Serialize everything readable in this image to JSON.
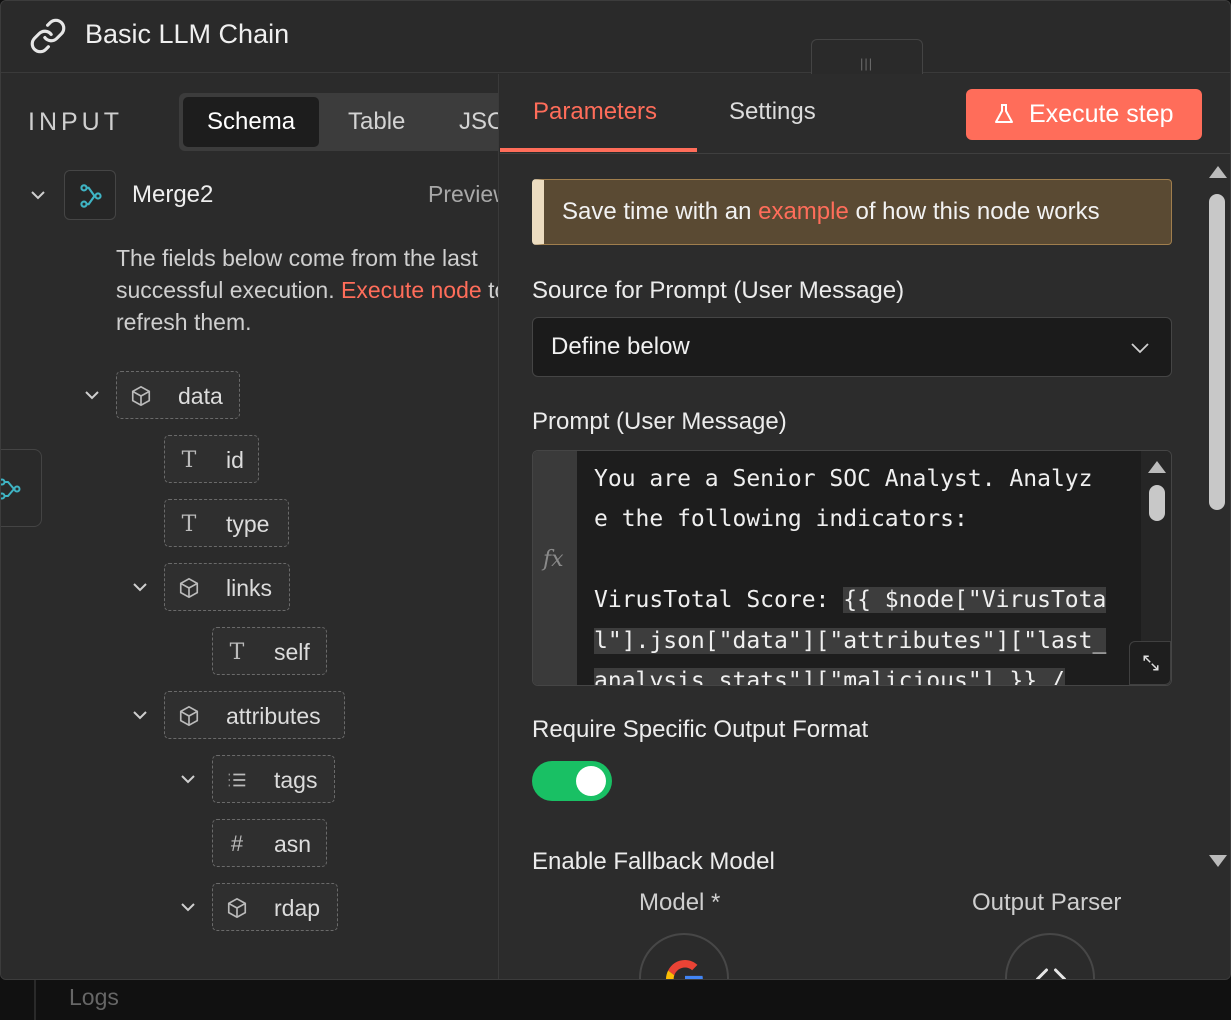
{
  "header": {
    "title": "Basic LLM Chain",
    "icon": "link-icon"
  },
  "input_panel": {
    "label": "INPUT",
    "view_tabs": [
      "Schema",
      "Table",
      "JSON"
    ],
    "active_tab": "Schema",
    "node": {
      "name": "Merge2",
      "preview_label": "Preview"
    },
    "description": {
      "before": "The fields below come from the last successful execution. ",
      "link": "Execute node",
      "after": " to refresh them."
    },
    "fields": [
      {
        "label": "data",
        "type": "object"
      },
      {
        "label": "id",
        "type": "string"
      },
      {
        "label": "type",
        "type": "string"
      },
      {
        "label": "links",
        "type": "object"
      },
      {
        "label": "self",
        "type": "string"
      },
      {
        "label": "attributes",
        "type": "object"
      },
      {
        "label": "tags",
        "type": "array"
      },
      {
        "label": "asn",
        "type": "number"
      },
      {
        "label": "rdap",
        "type": "object"
      }
    ]
  },
  "params_panel": {
    "tabs": [
      "Parameters",
      "Settings"
    ],
    "active_tab": "Parameters",
    "execute_label": "Execute step",
    "callout": {
      "before": "Save time with an ",
      "link": "example",
      "after": " of how this node works"
    },
    "source_label": "Source for Prompt (User Message)",
    "source_value": "Define below",
    "prompt_label": "Prompt (User Message)",
    "prompt_lines": [
      {
        "text": "You are a Senior SOC Analyst. Analyz",
        "expr": ""
      },
      {
        "text": "e the following indicators:",
        "expr": ""
      },
      {
        "text": "",
        "expr": ""
      },
      {
        "text": "VirusTotal Score: ",
        "expr": "{{ $node[\"VirusTota"
      },
      {
        "text": "",
        "expr": "l\"].json[\"data\"][\"attributes\"][\"last_"
      },
      {
        "text": "",
        "expr": "analysis_stats\"][\"malicious\"] }} /"
      }
    ],
    "fx_label": "fx",
    "output_format_label": "Require Specific Output Format",
    "output_format_enabled": true,
    "fallback_label": "Enable Fallback Model",
    "model_label": "Model *",
    "parser_label": "Output Parser"
  },
  "footer": {
    "logs_label": "Logs"
  },
  "colors": {
    "accent": "#ff6d5a",
    "toggle_on": "#19c064",
    "callout_bg": "#5a4a33"
  }
}
